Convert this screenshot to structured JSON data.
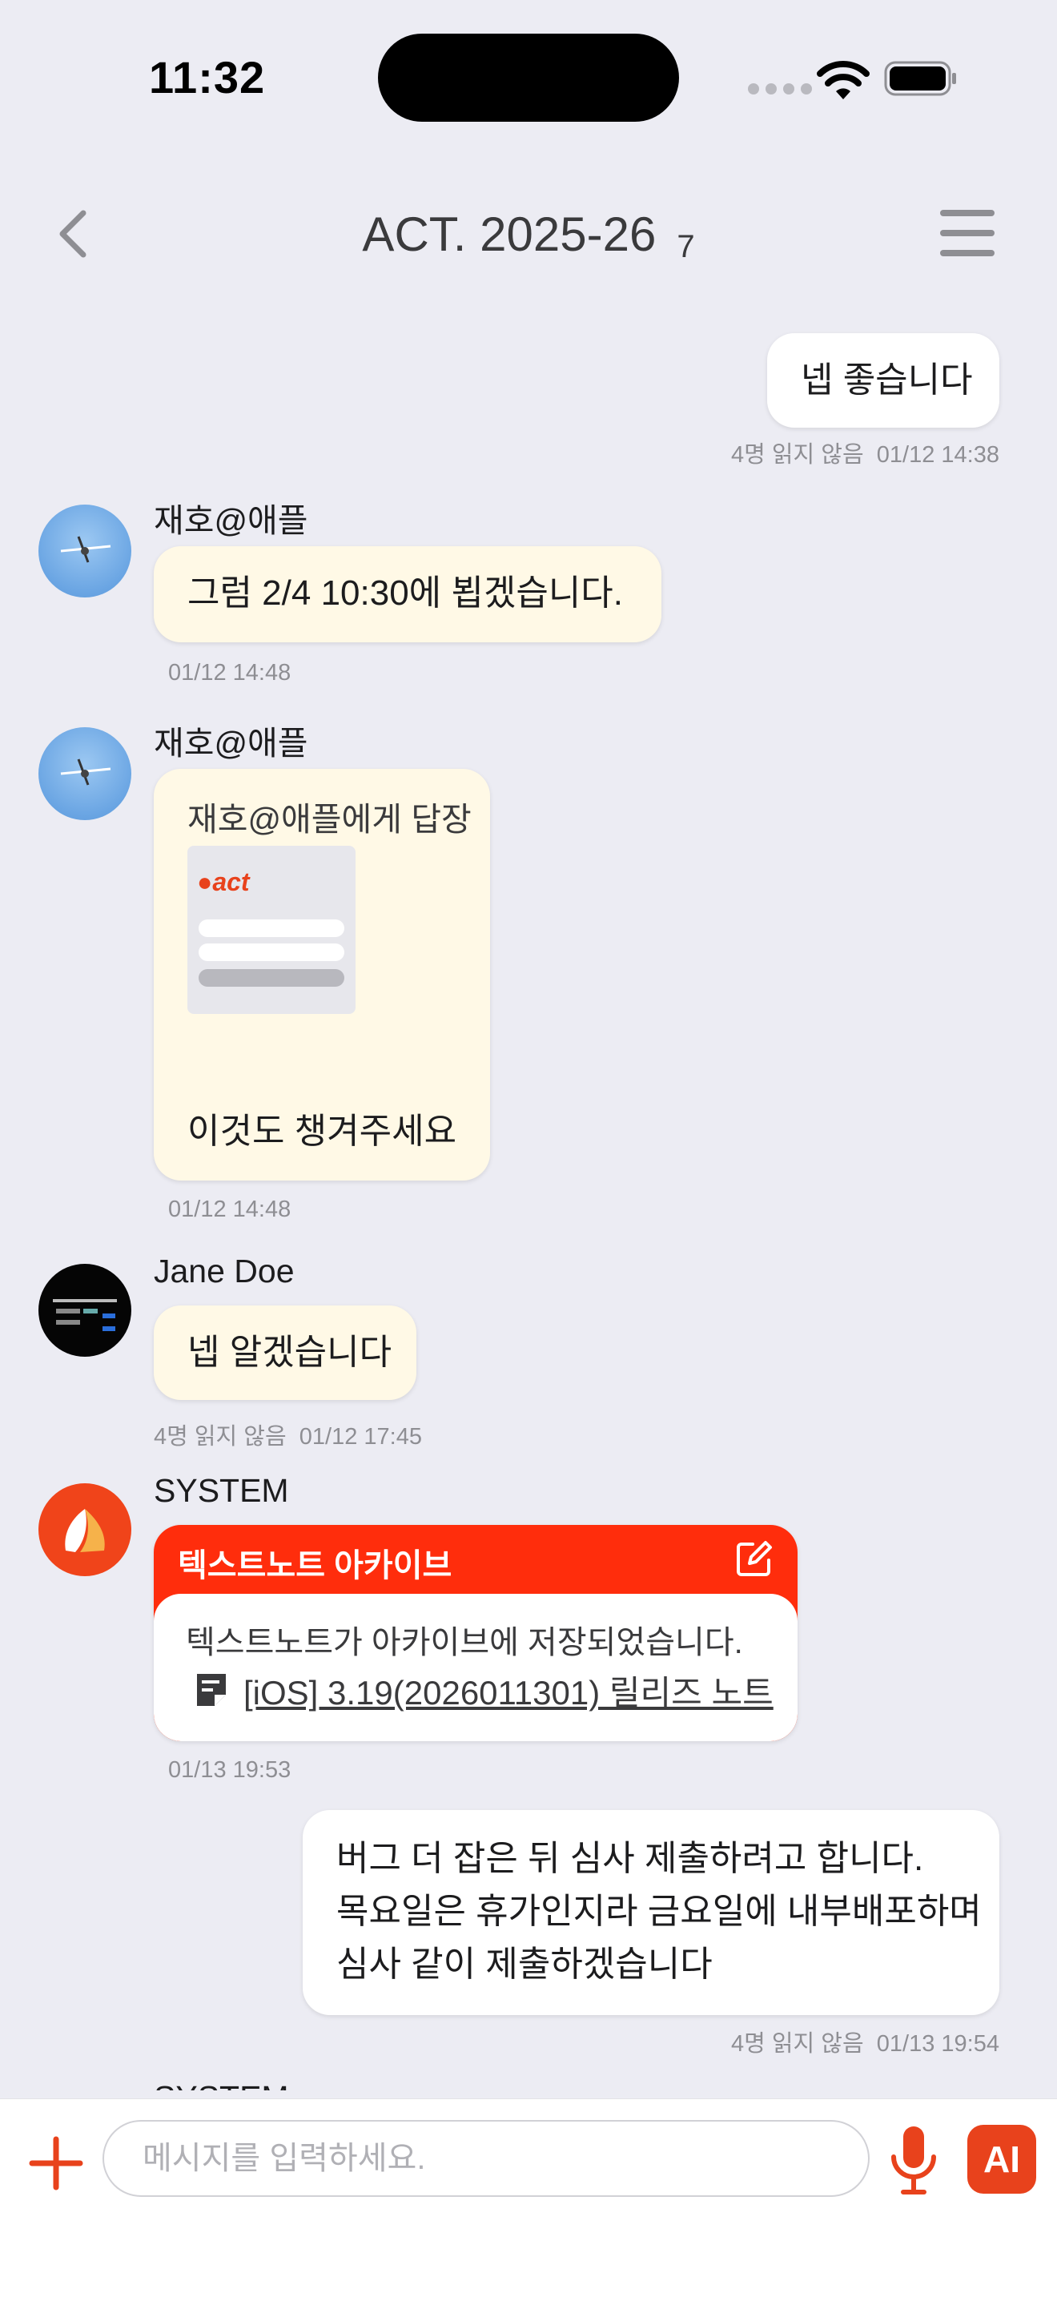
{
  "status_bar": {
    "time": "11:32"
  },
  "header": {
    "title": "ACT. 2025-26",
    "member_count": "7"
  },
  "messages": [
    {
      "text": "넵 좋습니다",
      "read_status": "4명 읽지 않음",
      "time": "01/12 14:38"
    },
    {
      "sender": "재호@애플",
      "text": "그럼 2/4 10:30에 뵙겠습니다.",
      "time": "01/12 14:48"
    },
    {
      "sender": "재호@애플",
      "reply_caption": "재호@애플에게 답장",
      "thumb_logo": "act",
      "text": "이것도 챙겨주세요",
      "time": "01/12 14:48"
    },
    {
      "sender": "Jane Doe",
      "text": "넵 알겠습니다",
      "read_status": "4명 읽지 않음",
      "time": "01/12 17:45"
    },
    {
      "sender": "SYSTEM",
      "card_title": "텍스트노트 아카이브",
      "card_text": "텍스트노트가 아카이브에 저장되었습니다.",
      "card_link": "[iOS] 3.19(2026011301) 릴리즈 노트",
      "time": "01/13 19:53"
    },
    {
      "lines": [
        "버그 더 잡은 뒤 심사 제출하려고 합니다.",
        "목요일은 휴가인지라 금요일에 내부배포하며",
        "심사 같이 제출하겠습니다"
      ],
      "read_status": "4명 읽지 않음",
      "time": "01/13 19:54"
    },
    {
      "sender": "SYSTEM"
    }
  ],
  "input": {
    "placeholder": "메시지를 입력하세요.",
    "ai_label": "AI"
  },
  "colors": {
    "accent": "#E8421C",
    "card_header": "#FF2D0C",
    "their_bubble": "#FFF9E6",
    "background": "#ECECF3"
  },
  "icons": [
    "back-icon",
    "menu-icon",
    "edit-icon",
    "document-icon",
    "plus-icon",
    "microphone-icon",
    "wifi-icon",
    "battery-icon"
  ]
}
